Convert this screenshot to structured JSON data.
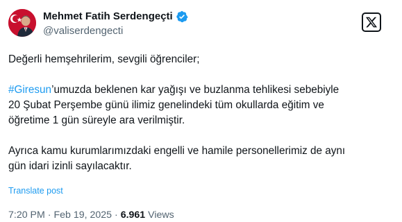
{
  "author": {
    "display_name": "Mehmet Fatih Serdengeçti",
    "handle": "@valiserdengecti",
    "verified": true,
    "verified_color": "#1d9bf0",
    "avatar_icon": "flag-portrait-avatar"
  },
  "brand": {
    "logo_icon": "x-logo-icon"
  },
  "post": {
    "line1": "Değerli hemşehrilerim, sevgili öğrenciler;",
    "hashtag": "#Giresun",
    "line2_rest": "’umuzda beklenen kar yağışı ve buzlanma tehlikesi sebebiyle",
    "line3": "20 Şubat Perşembe günü ilimiz genelindeki tüm okullarda eğitim ve",
    "line4": "öğretime 1 gün süreyle ara verilmiştir.",
    "line5": "Ayrıca kamu kurumlarımızdaki engelli ve hamile personellerimiz de aynı",
    "line6": "gün idari izinli sayılacaktır."
  },
  "actions": {
    "translate_label": "Translate post"
  },
  "meta": {
    "time": "7:20 PM",
    "separator": " · ",
    "date": "Feb 19, 2025",
    "separator2": " · ",
    "views_count": "6.961",
    "views_label": " Views"
  },
  "colors": {
    "text": "#0f1419",
    "secondary": "#536471",
    "accent": "#1d9bf0"
  }
}
